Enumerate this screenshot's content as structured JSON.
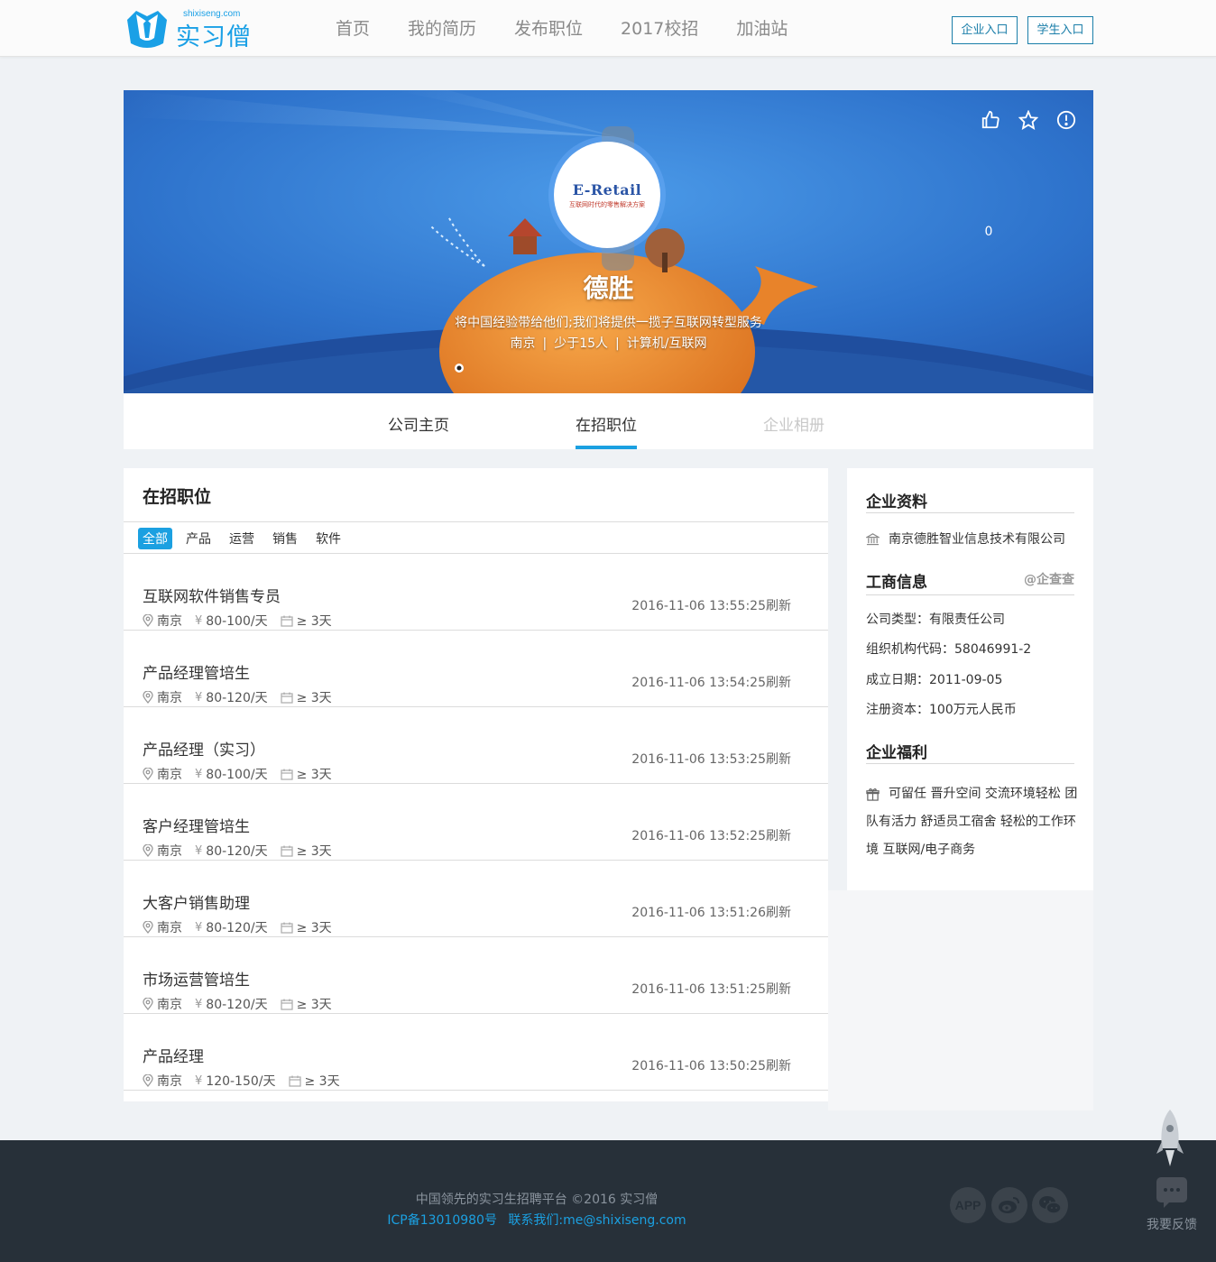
{
  "header": {
    "logo_domain": "shixiseng.com",
    "logo_name": "实习僧",
    "nav": [
      "首页",
      "我的简历",
      "发布职位",
      "2017校招",
      "加油站"
    ],
    "company_entry": "企业入口",
    "student_entry": "学生入口"
  },
  "banner": {
    "like_count": "0",
    "logo_text": "E-Retail",
    "logo_subtext": "互联网时代的零售解决方案",
    "company_name": "德胜",
    "slogan": "将中国经验带给他们;我们将提供一揽子互联网转型服务",
    "city": "南京",
    "size": "少于15人",
    "industry": "计算机/互联网",
    "meta_sep": "|"
  },
  "tabs": [
    "公司主页",
    "在招职位",
    "企业相册"
  ],
  "jobs": {
    "title": "在招职位",
    "filters": [
      "全部",
      "产品",
      "运营",
      "销售",
      "软件"
    ],
    "items": [
      {
        "title": "互联网软件销售专员",
        "city": "南京",
        "salary": "80-100/天",
        "days": "≥ 3天",
        "time": "2016-11-06 13:55:25刷新"
      },
      {
        "title": "产品经理管培生",
        "city": "南京",
        "salary": "80-120/天",
        "days": "≥ 3天",
        "time": "2016-11-06 13:54:25刷新"
      },
      {
        "title": "产品经理（实习）",
        "city": "南京",
        "salary": "80-100/天",
        "days": "≥ 3天",
        "time": "2016-11-06 13:53:25刷新"
      },
      {
        "title": "客户经理管培生",
        "city": "南京",
        "salary": "80-120/天",
        "days": "≥ 3天",
        "time": "2016-11-06 13:52:25刷新"
      },
      {
        "title": "大客户销售助理",
        "city": "南京",
        "salary": "80-120/天",
        "days": "≥ 3天",
        "time": "2016-11-06 13:51:26刷新"
      },
      {
        "title": "市场运营管培生",
        "city": "南京",
        "salary": "80-120/天",
        "days": "≥ 3天",
        "time": "2016-11-06 13:51:25刷新"
      },
      {
        "title": "产品经理",
        "city": "南京",
        "salary": "120-150/天",
        "days": "≥ 3天",
        "time": "2016-11-06 13:50:25刷新"
      }
    ],
    "yen": "¥"
  },
  "sidebar": {
    "profile_title": "企业资料",
    "full_name": "南京德胜智业信息技术有限公司",
    "biz_title": "工商信息",
    "biz_source": "@企查查",
    "company_type": "公司类型：有限责任公司",
    "org_code": "组织机构代码：58046991-2",
    "founded": "成立日期：2011-09-05",
    "capital": "注册资本：100万元人民币",
    "welfare_title": "企业福利",
    "welfare_text": "可留任 晋升空间 交流环境轻松 团队有活力 舒适员工宿舍 轻松的工作环境 互联网/电子商务"
  },
  "footer": {
    "copyright": "中国领先的实习生招聘平台 ©2016 实习僧",
    "icp": "ICP备13010980号",
    "contact": "联系我们:me@shixiseng.com",
    "app_label": "APP",
    "feedback": "我要反馈"
  },
  "colors": {
    "accent": "#1ba0e1",
    "footer_bg": "#273039",
    "banner_blue": "#2a6fc6"
  }
}
